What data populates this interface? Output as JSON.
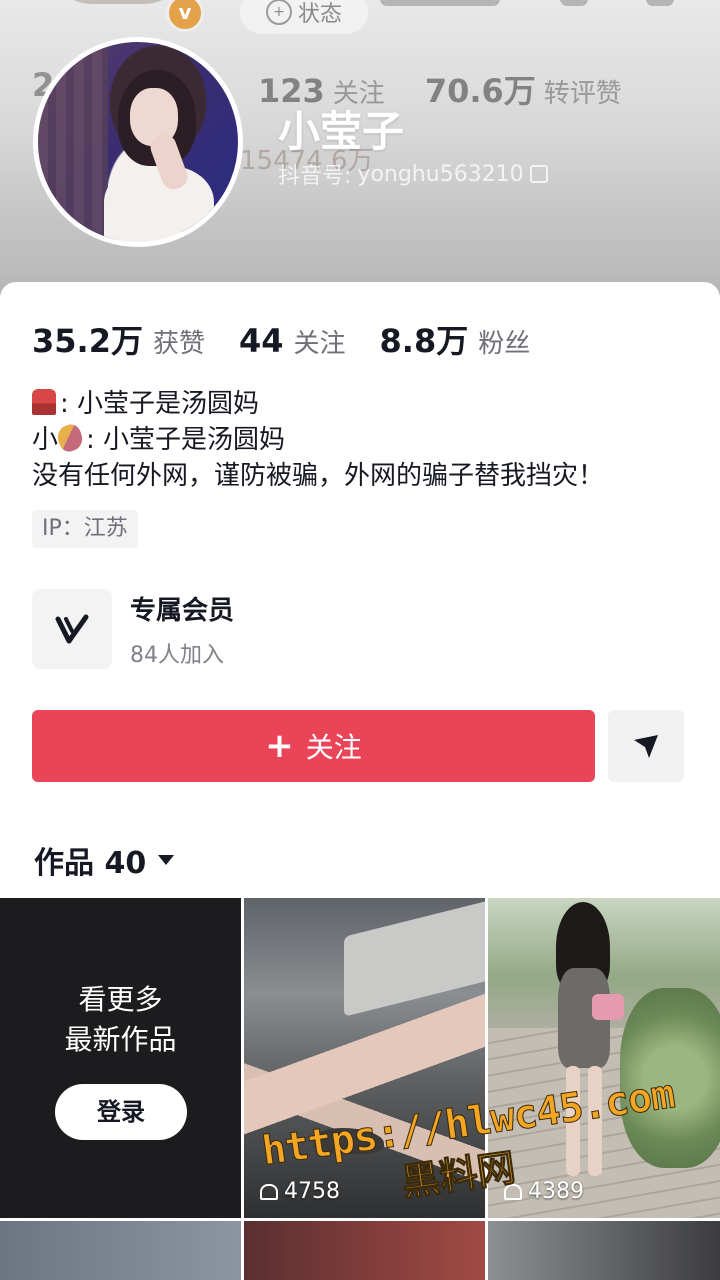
{
  "header": {
    "status_label": "状态",
    "ghost_stats": [
      {
        "num": "123",
        "label": "关注"
      },
      {
        "num": "70.6万",
        "label": "转评赞"
      }
    ],
    "ghost_partial_num": "2",
    "ghost_amount": "15474.6万",
    "verified_badge": "v-badge-icon"
  },
  "profile": {
    "name": "小莹子",
    "douyin_id_label": "抖音号:",
    "douyin_id": "yonghu563210"
  },
  "stats": [
    {
      "num": "35.2万",
      "label": "获赞"
    },
    {
      "num": "44",
      "label": "关注"
    },
    {
      "num": "8.8万",
      "label": "粉丝"
    }
  ],
  "bio": {
    "line1": ": 小莹子是汤圆妈",
    "line2_prefix": "小",
    "line2": ": 小莹子是汤圆妈",
    "line3": "没有任何外网，谨防被骗，外网的骗子替我挡灾！"
  },
  "ip_tag": "IP：江苏",
  "vip": {
    "title": "专属会员",
    "subtitle": "84人加入"
  },
  "actions": {
    "follow_label": "关注",
    "share_icon": "send-icon"
  },
  "works_tab": {
    "label": "作品 40"
  },
  "grid": {
    "login_line1": "看更多",
    "login_line2": "最新作品",
    "login_button": "登录",
    "video2_count": "4758",
    "video3_count": "4389"
  },
  "watermark": {
    "url": "https://hlwc45.com",
    "name": "黑料网"
  }
}
